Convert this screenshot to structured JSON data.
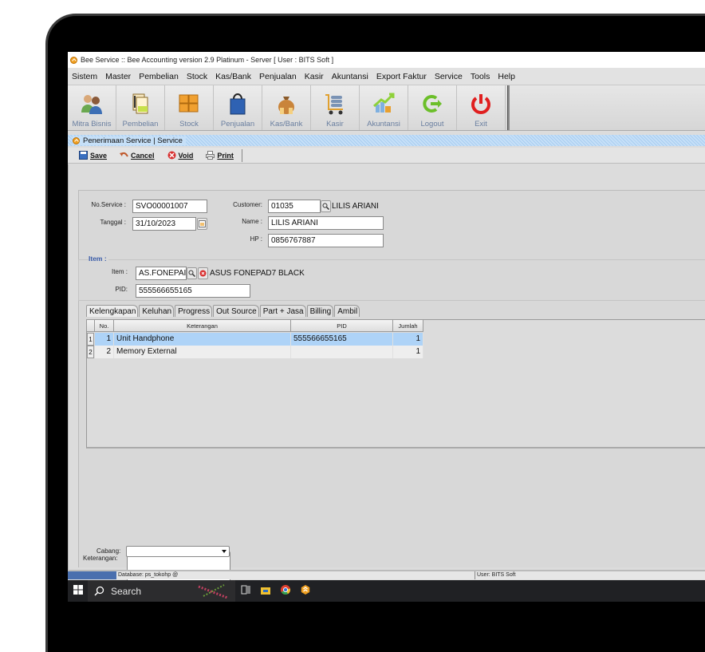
{
  "window": {
    "title": "Bee Service :: Bee Accounting version 2.9 Platinum - Server  [ User : BITS Soft ]"
  },
  "menu": [
    "Sistem",
    "Master",
    "Pembelian",
    "Stock",
    "Kas/Bank",
    "Penjualan",
    "Kasir",
    "Akuntansi",
    "Export Faktur",
    "Service",
    "Tools",
    "Help"
  ],
  "toolbar": [
    {
      "label": "Mitra Bisnis",
      "icon": "people-icon"
    },
    {
      "label": "Pembelian",
      "icon": "documents-icon"
    },
    {
      "label": "Stock",
      "icon": "boxes-icon"
    },
    {
      "label": "Penjualan",
      "icon": "shopping-bag-icon"
    },
    {
      "label": "Kas/Bank",
      "icon": "money-bag-icon"
    },
    {
      "label": "Kasir",
      "icon": "cart-icon"
    },
    {
      "label": "Akuntansi",
      "icon": "chart-up-icon"
    },
    {
      "label": "Logout",
      "icon": "logout-icon"
    },
    {
      "label": "Exit",
      "icon": "power-icon"
    }
  ],
  "form": {
    "title": "Penerimaan Service | Service",
    "actions": {
      "save": "Save",
      "cancel": "Cancel",
      "void": "Void",
      "print": "Print"
    },
    "no_service_label": "No.Service :",
    "no_service": "SVO00001007",
    "tanggal_label": "Tanggal :",
    "tanggal": "31/10/2023",
    "customer_label": "Customer:",
    "customer_code": "01035",
    "customer_name_display": "LILIS ARIANI",
    "name_label": "Name :",
    "name": "LILIS ARIANI",
    "hp_label": "HP :",
    "hp": "0856767887",
    "item_group_label": "Item :",
    "item_label": "Item :",
    "item_code": "AS.FONEPAI",
    "item_name_display": "ASUS FONEPAD7 BLACK",
    "pid_label": "PID:",
    "pid": "555566655165",
    "keterangan_label": "Keterangan:",
    "keterangan": "",
    "cabang_label": "Cabang:",
    "cabang": ""
  },
  "tabs": [
    "Kelengkapan",
    "Keluhan",
    "Progress",
    "Out Source",
    "Part + Jasa",
    "Billing",
    "Ambil"
  ],
  "grid": {
    "columns": [
      "No.",
      "Keterangan",
      "PID",
      "Jumlah"
    ],
    "rows": [
      {
        "index": "1",
        "no": "1",
        "keterangan": "Unit Handphone",
        "pid": "555566655165",
        "jumlah": "1"
      },
      {
        "index": "2",
        "no": "2",
        "keterangan": "Memory External",
        "pid": "",
        "jumlah": "1"
      }
    ]
  },
  "status": {
    "database": "Database: ps_tokohp @",
    "user": "User: BITS Soft"
  },
  "taskbar": {
    "search": "Search"
  },
  "colors": {
    "selection": "#aed3f7",
    "form_title_bg": "#c6e0f8",
    "group_title": "#3a5ca8",
    "status_blue": "#4a6fae"
  }
}
